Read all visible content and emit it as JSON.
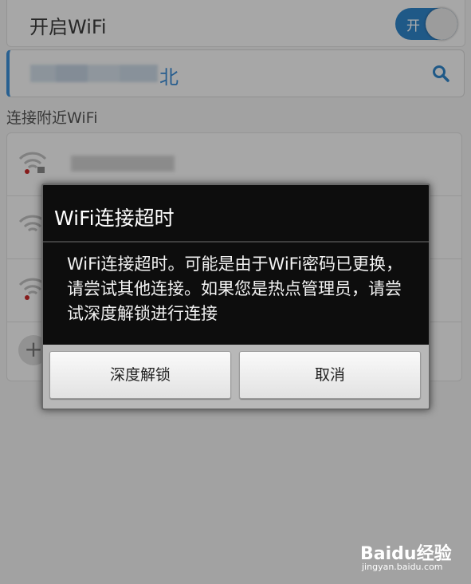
{
  "background": {
    "wifi_toggle_label": "开启WiFi",
    "toggle_state": "开",
    "current_ssid_suffix": "北",
    "section_label": "连接附近WiFi"
  },
  "dialog": {
    "title": "WiFi连接超时",
    "message": "WiFi连接超时。可能是由于WiFi密码已更换，请尝试其他连接。如果您是热点管理员，请尝试深度解锁进行连接",
    "buttons": {
      "unlock": "深度解锁",
      "cancel": "取消"
    }
  },
  "watermark": {
    "brand": "Baidu经验",
    "url": "jingyan.baidu.com"
  },
  "colors": {
    "accent": "#2f83c8",
    "dialog_bg": "#0d0d0d"
  }
}
